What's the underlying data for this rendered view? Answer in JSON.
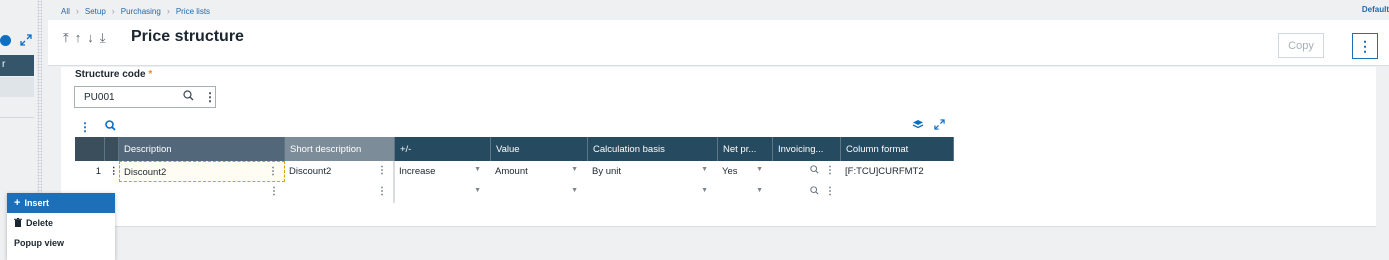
{
  "breadcrumb": [
    "All",
    "Setup",
    "Purchasing",
    "Price lists"
  ],
  "default_link": "Default",
  "sidebar": {
    "tab_label": "r"
  },
  "header": {
    "title": "Price structure",
    "nav_icons": [
      "first-icon",
      "up-icon",
      "down-icon",
      "last-icon"
    ],
    "copy_label": "Copy",
    "more_icon": "kebab-icon"
  },
  "form": {
    "structure_code_label": "Structure code",
    "required_marker": "*",
    "structure_code_value": "PU001"
  },
  "grid": {
    "columns": [
      "Description",
      "Short description",
      "+/-",
      "Value",
      "Calculation basis",
      "Net pr...",
      "Invoicing...",
      "Column format"
    ],
    "rows": [
      {
        "num": "1",
        "description": "Discount2",
        "short_description": "Discount2",
        "sign": "Increase",
        "value": "Amount",
        "calculation_basis": "By unit",
        "net_price": "Yes",
        "invoicing": "",
        "column_format": "[F:TCU]CURFMT2"
      },
      {
        "num": "",
        "description": "",
        "short_description": "",
        "sign": "",
        "value": "",
        "calculation_basis": "",
        "net_price": "",
        "invoicing": "",
        "column_format": ""
      }
    ]
  },
  "context_menu": {
    "items": [
      {
        "label": "Insert",
        "icon": "plus-icon",
        "active": true
      },
      {
        "label": "Delete",
        "icon": "trash-icon",
        "active": false
      },
      {
        "label": "Popup view",
        "icon": "",
        "active": false
      }
    ]
  },
  "colors": {
    "accent": "#1d6fb8",
    "grid_header": "#264a5f",
    "required": "#f08a1b"
  }
}
